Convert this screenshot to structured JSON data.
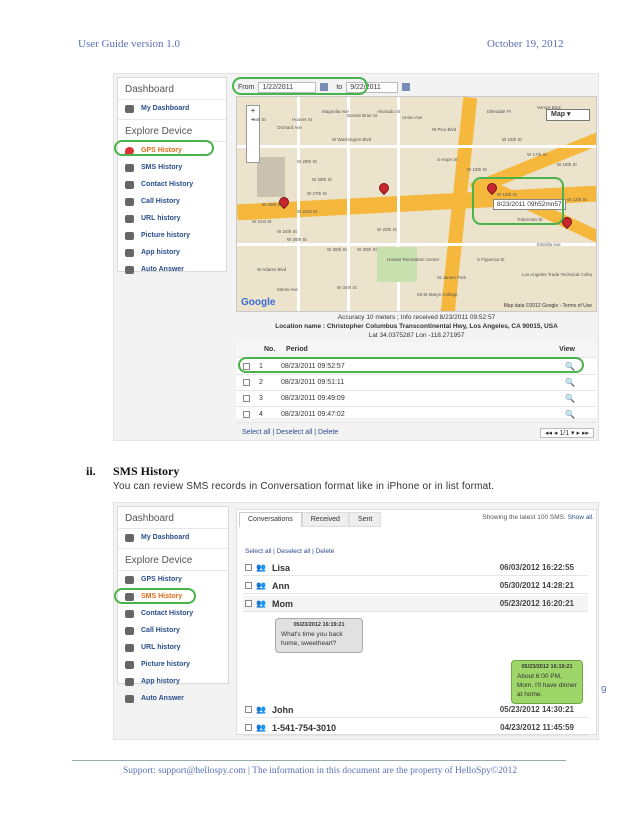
{
  "header": {
    "left": "User Guide version 1.0",
    "right": "October 19, 2012"
  },
  "footer": "Support: support@hellospy.com | The information in this document are the property of HelloSpy©2012",
  "page_num": "9",
  "section": {
    "numeral": "ii.",
    "title": "SMS History",
    "desc": "You can review SMS records in Conversation format like in iPhone or in list format."
  },
  "sidebar": {
    "dashboard": "Dashboard",
    "my_dashboard": "My Dashboard",
    "explore": "Explore Device",
    "items": [
      "GPS History",
      "SMS History",
      "Contact History",
      "Call History",
      "URL history",
      "Picture history",
      "App history",
      "Auto Answer"
    ]
  },
  "gps": {
    "from_label": "From",
    "from_date": "1/22/2011",
    "to_label": "to",
    "to_date": "9/22/2011",
    "map_button": "Map",
    "popup": "8/23/2011 09h52mn57",
    "map_logo": "Google",
    "map_data": "Map data ©2012 Google - Terms of Use",
    "streets": [
      "W Washington Blvd",
      "W 29th St",
      "W 28th St",
      "W Adams Blvd",
      "W 21st St",
      "W 24th St",
      "W 26th St",
      "W 23rd St",
      "W Pico Blvd",
      "W 16th St",
      "W 17th St",
      "W 18th St",
      "Venice Blvd",
      "W 12th St",
      "Hoover Recreation Center",
      "Mt St Marys College",
      "St James Park",
      "Los Angeles Trade Technical College",
      "W 27th St",
      "W 35th St",
      "W 30th St",
      "W 34th St",
      "Toberman St",
      "Oak St",
      "Orchard Ave",
      "Hoover St",
      "Magnolia Ave",
      "Bonnie Brae St",
      "Alvarado St",
      "Union Ave",
      "Ellendale Pl",
      "Menlo Ave",
      "S Hope St",
      "W 15th St",
      "W 14th St",
      "Estrella Ave",
      "S Figueroa St",
      "W 20th St",
      "W 25th St"
    ],
    "accuracy": "Accuracy 10 meters ; Info received 8/23/2011 09:52:57",
    "location": "Location name : Christopher Columbus Transcontinental Hwy, Los Angeles, CA 90015, USA",
    "latlon": "Lat 34.0375287  Lon -118.271957",
    "table": {
      "col_no": "No.",
      "col_period": "Period",
      "col_view": "View",
      "rows": [
        {
          "no": "1",
          "period": "08/23/2011 09:52:57"
        },
        {
          "no": "2",
          "period": "08/23/2011 09:51:11"
        },
        {
          "no": "3",
          "period": "08/23/2011 09:49:09"
        },
        {
          "no": "4",
          "period": "08/23/2011 09:47:02"
        }
      ]
    },
    "select_all": "Select all",
    "deselect_all": "Deselect all",
    "delete": "Delete",
    "pager": "1/1"
  },
  "sms": {
    "tabs": [
      "Conversations",
      "Received",
      "Sent"
    ],
    "showing": "Showing the latest 100 SMS.",
    "show_all": "Show all.",
    "select_all": "Select all",
    "deselect_all": "Deselect all",
    "delete": "Delete",
    "rows": [
      {
        "name": "Lisa",
        "date": "06/03/2012 16:22:55"
      },
      {
        "name": "Ann",
        "date": "05/30/2012 14:28:21"
      },
      {
        "name": "Mom",
        "date": "05/23/2012 16:20:21"
      },
      {
        "name": "John",
        "date": "05/23/2012 14:30:21"
      },
      {
        "name": "1-541-754-3010",
        "date": "04/23/2012 11:45:59"
      }
    ],
    "bubble_in": {
      "time": "05/23/2012 16:19:21",
      "text": "What's time you back home, sweetheart?"
    },
    "bubble_out": {
      "time": "05/23/2012 16:19:21",
      "text": "About 6:00 PM, Mom. I'll have dinner at home."
    }
  },
  "colors": {
    "accent_green": "#4ab24a",
    "link": "#2a4d8a",
    "active": "#e06b16",
    "header_blue": "#5b6fb5"
  }
}
